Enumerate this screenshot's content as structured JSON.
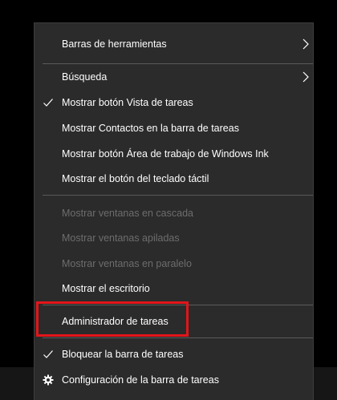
{
  "menu": {
    "items": [
      {
        "label": "Barras de herramientas",
        "submenu": true,
        "checked": false,
        "disabled": false
      },
      {
        "label": "Búsqueda",
        "submenu": true,
        "checked": false,
        "disabled": false
      },
      {
        "label": "Mostrar botón Vista de tareas",
        "submenu": false,
        "checked": true,
        "disabled": false
      },
      {
        "label": "Mostrar Contactos en la barra de tareas",
        "submenu": false,
        "checked": false,
        "disabled": false
      },
      {
        "label": "Mostrar botón Área de trabajo de Windows Ink",
        "submenu": false,
        "checked": false,
        "disabled": false
      },
      {
        "label": "Mostrar el botón del teclado táctil",
        "submenu": false,
        "checked": false,
        "disabled": false
      },
      {
        "label": "Mostrar ventanas en cascada",
        "submenu": false,
        "checked": false,
        "disabled": true
      },
      {
        "label": "Mostrar ventanas apiladas",
        "submenu": false,
        "checked": false,
        "disabled": true
      },
      {
        "label": "Mostrar ventanas en paralelo",
        "submenu": false,
        "checked": false,
        "disabled": true
      },
      {
        "label": "Mostrar el escritorio",
        "submenu": false,
        "checked": false,
        "disabled": false
      },
      {
        "label": "Administrador de tareas",
        "submenu": false,
        "checked": false,
        "disabled": false,
        "highlighted": true
      },
      {
        "label": "Bloquear la barra de tareas",
        "submenu": false,
        "checked": true,
        "disabled": false
      },
      {
        "label": "Configuración de la barra de tareas",
        "submenu": false,
        "checked": false,
        "disabled": false,
        "icon": "gear-icon"
      }
    ]
  },
  "colors": {
    "menu_background": "#2b2b2b",
    "text": "#ffffff",
    "disabled_text": "#6d6d6d",
    "separator": "#5a5a5a",
    "highlight_border": "#e3151a"
  }
}
